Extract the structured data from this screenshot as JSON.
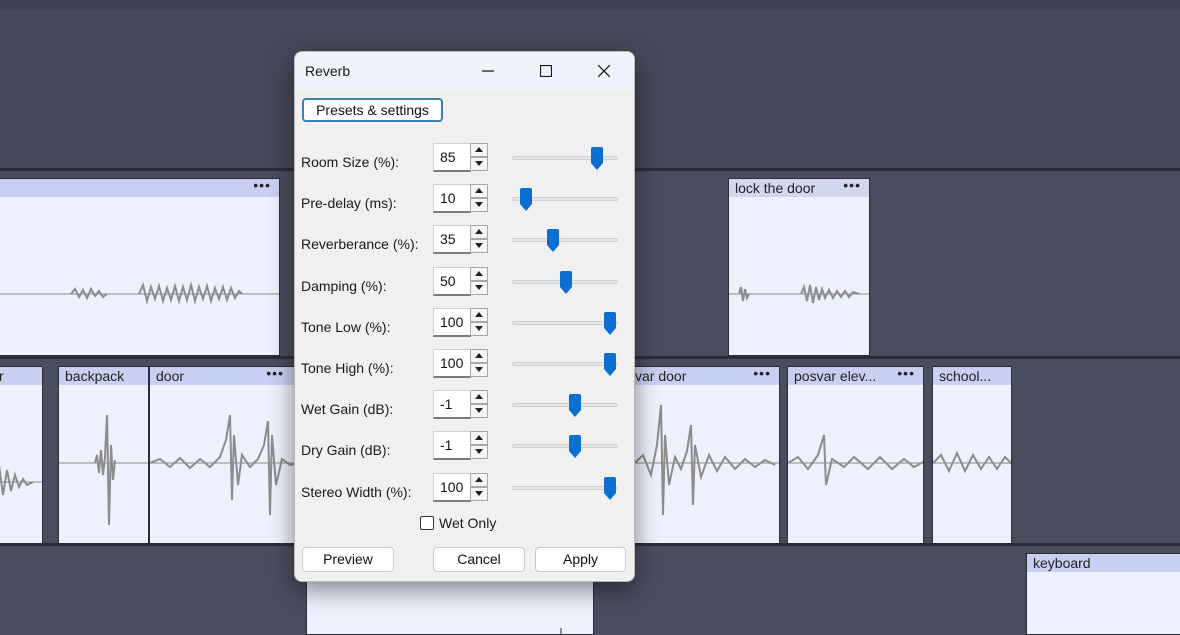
{
  "dialog": {
    "title": "Reverb",
    "presets_label": "Presets & settings",
    "params": [
      {
        "label": "Room Size (%):",
        "value": "85",
        "level": 0.85
      },
      {
        "label": "Pre-delay (ms):",
        "value": "10",
        "level": 0.05
      },
      {
        "label": "Reverberance (%):",
        "value": "35",
        "level": 0.35
      },
      {
        "label": "Damping (%):",
        "value": "50",
        "level": 0.5
      },
      {
        "label": "Tone Low (%):",
        "value": "100",
        "level": 1.0
      },
      {
        "label": "Tone High (%):",
        "value": "100",
        "level": 1.0
      },
      {
        "label": "Wet Gain (dB):",
        "value": "-1",
        "level": 0.6
      },
      {
        "label": "Dry Gain (dB):",
        "value": "-1",
        "level": 0.6
      },
      {
        "label": "Stereo Width (%):",
        "value": "100",
        "level": 1.0
      }
    ],
    "wet_only_label": "Wet Only",
    "wet_only_checked": false,
    "preview_label": "Preview",
    "cancel_label": "Cancel",
    "apply_label": "Apply"
  },
  "clips": {
    "track1_a": {
      "name": "",
      "menu": "•••"
    },
    "lock_door": {
      "name": "lock the door",
      "menu": "•••"
    },
    "partial": {
      "name": "r"
    },
    "backpack": {
      "name": "backpack"
    },
    "door": {
      "name": "door",
      "menu": "•••"
    },
    "posvar_door": {
      "name": "var door",
      "menu": "•••"
    },
    "posvar_elev": {
      "name": "posvar elev...",
      "menu": "•••"
    },
    "school": {
      "name": "school..."
    },
    "keyboard": {
      "name": "keyboard"
    }
  },
  "colors": {
    "accent": "#0b6fd1",
    "clip_header": "#c9cff0",
    "clip_body": "#eef0fb",
    "waveform": "#8c8c8c",
    "timeline_bg": "#4a4d5e"
  }
}
